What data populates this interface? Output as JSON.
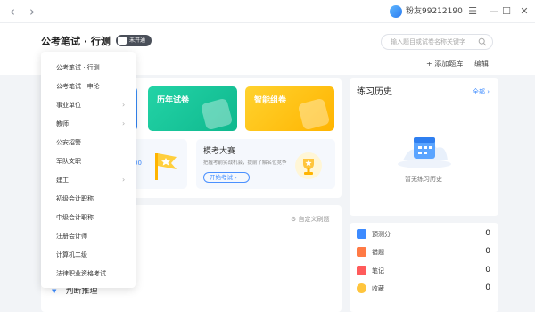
{
  "user": {
    "name": "粉友99212190"
  },
  "header": {
    "exam_title": "公考笔试 · 行测",
    "badge": "未开通",
    "search_placeholder": "输入题目或试卷名称关键字",
    "add_bank": "+ 添加题库",
    "edit": "编辑"
  },
  "tiles": {
    "history_papers": "历年试卷",
    "smart_set": "智能组卷"
  },
  "mock": {
    "left_partial": "00",
    "title": "模考大赛",
    "desc": "把握考前实战机会，提前了解名位竞争",
    "button": "开始考试 ›"
  },
  "lower": {
    "custom_sort": "自定义刷题",
    "judge": "判断推理"
  },
  "history": {
    "title": "练习历史",
    "all": "全部 ›",
    "empty": "暂无练习历史"
  },
  "stats": [
    {
      "label": "预测分",
      "value": "0",
      "icon": "forecast-icon",
      "color": "#3d8bff"
    },
    {
      "label": "错题",
      "value": "0",
      "icon": "wrong-icon",
      "color": "#ff7a45"
    },
    {
      "label": "笔记",
      "value": "0",
      "icon": "note-icon",
      "color": "#ff5b5b"
    },
    {
      "label": "收藏",
      "value": "0",
      "icon": "star-icon",
      "color": "#ffc53d"
    }
  ],
  "dropdown": {
    "items": [
      {
        "label": "公考笔试 · 行测"
      },
      {
        "label": "公考笔试 · 申论"
      },
      {
        "label": "事业单位"
      },
      {
        "label": "教师"
      },
      {
        "label": "公安招警"
      },
      {
        "label": "军队文职"
      },
      {
        "label": "建工"
      },
      {
        "label": "初级会计职称"
      },
      {
        "label": "中级会计职称"
      },
      {
        "label": "注册会计师"
      },
      {
        "label": "计算机二级"
      },
      {
        "label": "法律职业资格考试"
      }
    ]
  }
}
